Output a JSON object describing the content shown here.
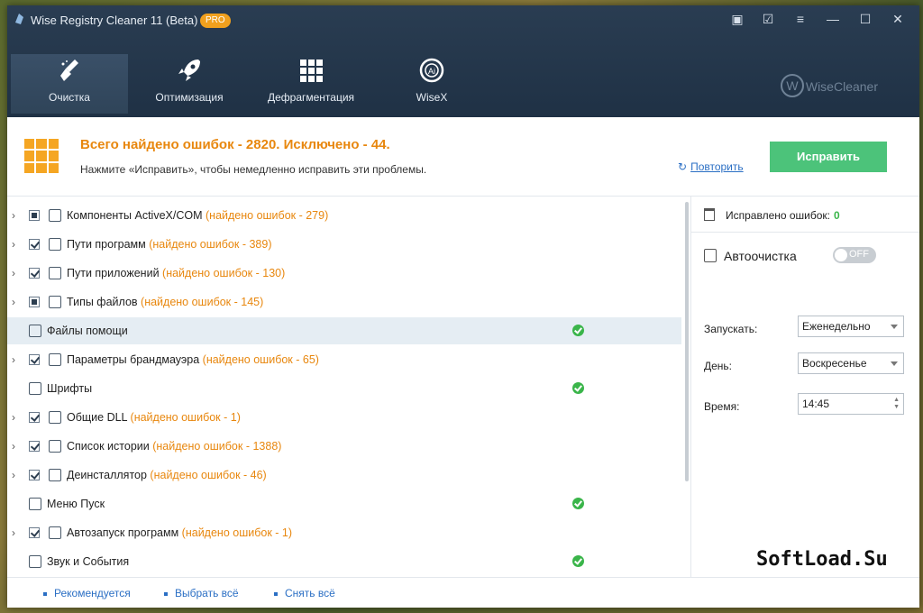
{
  "window": {
    "title": "Wise Registry Cleaner 11 (Beta)",
    "badge": "PRO",
    "controls": [
      "feedback-icon",
      "notes-icon",
      "menu-icon",
      "minimize-icon",
      "maximize-icon",
      "close-icon"
    ]
  },
  "nav": {
    "items": [
      {
        "label": "Очистка",
        "icon": "broom-icon",
        "active": true
      },
      {
        "label": "Оптимизация",
        "icon": "rocket-icon",
        "active": false
      },
      {
        "label": "Дефрагментация",
        "icon": "grid-icon",
        "active": false
      },
      {
        "label": "WiseX",
        "icon": "ai-icon",
        "active": false
      }
    ],
    "brand": "WiseCleaner",
    "brand_mark": "W"
  },
  "summary": {
    "title": "Всего найдено ошибок - 2820. Исключено - 44.",
    "subtitle": "Нажмите «Исправить», чтобы немедленно исправить эти проблемы.",
    "retry": "Повторить",
    "fix_button": "Исправить"
  },
  "list": [
    {
      "label": "Компоненты ActiveX/COM",
      "count": "(найдено ошибок - 279)",
      "check": "partial",
      "expandable": true,
      "ok": false
    },
    {
      "label": "Пути программ",
      "count": "(найдено ошибок - 389)",
      "check": "checked",
      "expandable": true,
      "ok": false
    },
    {
      "label": "Пути приложений",
      "count": "(найдено ошибок - 130)",
      "check": "checked",
      "expandable": true,
      "ok": false
    },
    {
      "label": "Типы файлов",
      "count": "(найдено ошибок - 145)",
      "check": "partial",
      "expandable": true,
      "ok": false
    },
    {
      "label": "Файлы помощи",
      "count": "",
      "check": "none",
      "expandable": false,
      "ok": true,
      "selected": true
    },
    {
      "label": "Параметры брандмауэра",
      "count": "(найдено ошибок - 65)",
      "check": "checked",
      "expandable": true,
      "ok": false
    },
    {
      "label": "Шрифты",
      "count": "",
      "check": "none",
      "expandable": false,
      "ok": true
    },
    {
      "label": "Общие DLL",
      "count": "(найдено ошибок - 1)",
      "check": "checked",
      "expandable": true,
      "ok": false
    },
    {
      "label": "Список истории",
      "count": "(найдено ошибок - 1388)",
      "check": "checked",
      "expandable": true,
      "ok": false
    },
    {
      "label": "Деинсталлятор",
      "count": "(найдено ошибок - 46)",
      "check": "checked",
      "expandable": true,
      "ok": false
    },
    {
      "label": "Меню Пуск",
      "count": "",
      "check": "none",
      "expandable": false,
      "ok": true
    },
    {
      "label": "Автозапуск программ",
      "count": "(найдено ошибок - 1)",
      "check": "checked",
      "expandable": true,
      "ok": false
    },
    {
      "label": "Звук и События",
      "count": "",
      "check": "none",
      "expandable": false,
      "ok": true
    }
  ],
  "panel": {
    "fixed_label": "Исправлено ошибок:",
    "fixed_value": "0",
    "autoclean_label": "Автоочистка",
    "toggle": "OFF",
    "run_label": "Запускать:",
    "run_value": "Еженедельно",
    "day_label": "День:",
    "day_value": "Воскресенье",
    "time_label": "Время:",
    "time_value": "14:45",
    "watermark": "SoftLoad.Su"
  },
  "footer": {
    "recommended": "Рекомендуется",
    "select_all": "Выбрать всё",
    "deselect_all": "Снять всё"
  }
}
